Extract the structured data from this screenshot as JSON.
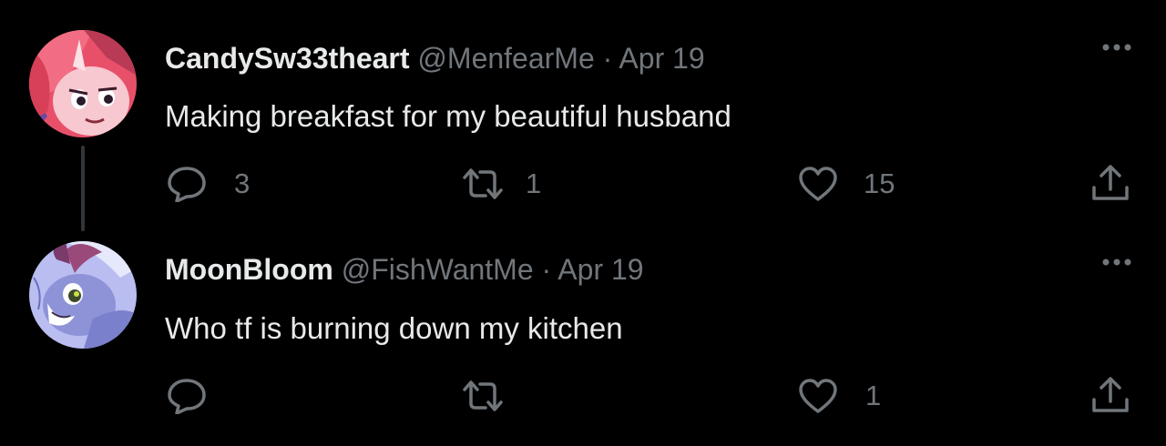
{
  "tweets": [
    {
      "display_name": "CandySw33theart",
      "handle": "@MenfearMe",
      "separator": "·",
      "date": "Apr 19",
      "text": "Making breakfast for my beautiful husband",
      "replies": "3",
      "retweets": "1",
      "likes": "15"
    },
    {
      "display_name": "MoonBloom",
      "handle": "@FishWantMe",
      "separator": "·",
      "date": "Apr 19",
      "text": "Who tf is burning down my kitchen",
      "replies": "",
      "retweets": "",
      "likes": "1"
    }
  ],
  "icons": [
    "reply-icon",
    "retweet-icon",
    "like-icon",
    "share-icon",
    "more-icon"
  ],
  "colors": {
    "background": "#000000",
    "primary_text": "#e7e9ea",
    "secondary_text": "#71767b",
    "thread_line": "#333639"
  }
}
